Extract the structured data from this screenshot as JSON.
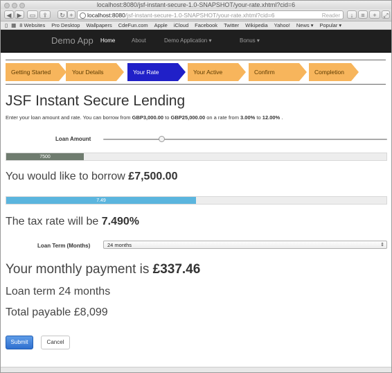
{
  "browser": {
    "title": "localhost:8080/jsf-instant-secure-1.0-SNAPSHOT/your-rate.xhtml?cid=6",
    "url_host": "localhost:8080",
    "url_path": "/jsf-instant-secure-1.0-SNAPSHOT/your-rate.xhtml?cid=6",
    "reader_label": "Reader",
    "bookmarks": [
      "8 Websites",
      "Pro Desktop",
      "Wallpapers",
      "CdeFun.com",
      "Apple",
      "iCloud",
      "Facebook",
      "Twitter",
      "Wikipedia",
      "Yahoo!",
      "News ▾",
      "Popular ▾"
    ]
  },
  "navbar": {
    "brand": "Demo App",
    "home": "Home",
    "about": "About",
    "demo_apps": "Demo Application ▾",
    "bonus": "Bonus ▾"
  },
  "steps": [
    "Getting Started",
    "Your Details",
    "Your Rate",
    "Your Active",
    "Confirm",
    "Completion"
  ],
  "active_step": "Your Rate",
  "heading": "JSF Instant Secure Lending",
  "intro": {
    "prefix": "Enter your loan amount and rate. You can borrow from",
    "min_amount": "GBP3,000.00",
    "to1": "to",
    "max_amount": "GBP25,000.00",
    "rate_prefix": "on a rate from",
    "min_rate": "3.00%",
    "to2": "to",
    "max_rate": "12.00%",
    "suffix": "."
  },
  "loan_amount": {
    "label": "Loan Amount",
    "slider_fraction": 0.2045,
    "bar_value": "7500",
    "bar_fraction": 0.2045
  },
  "borrow": {
    "text": "You would like to borrow",
    "amount": "£7,500.00"
  },
  "tax": {
    "bar_value": "7.49",
    "bar_fraction": 0.499,
    "text": "The tax rate will be",
    "rate": "7.490%"
  },
  "loan_term": {
    "label": "Loan Term (Months)",
    "selected": "24 months"
  },
  "monthly": {
    "text": "Your monthly payment is",
    "amount": "£337.46"
  },
  "term_text": "Loan term 24 months",
  "total_text": "Total payable £8,099",
  "buttons": {
    "submit": "Submit",
    "cancel": "Cancel"
  },
  "colors": {
    "step_inactive": "#f7b55c",
    "step_active": "#2020c8",
    "amount_bar": "#6f7c6f",
    "tax_bar": "#5bb5de",
    "navbar": "#1f1f1f"
  }
}
